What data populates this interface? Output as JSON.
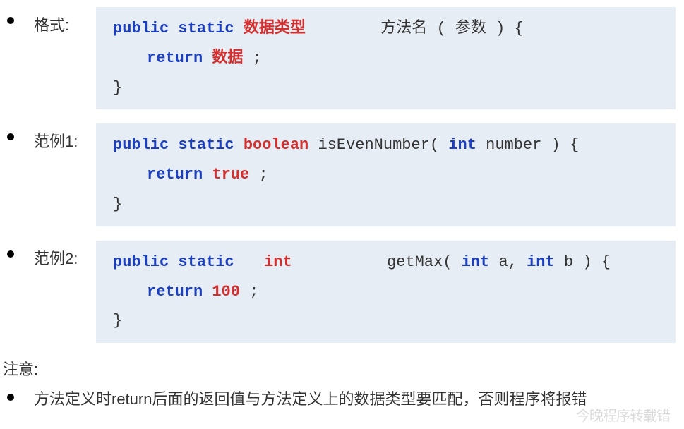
{
  "sections": {
    "format_label": "格式:",
    "example1_label": "范例1:",
    "example2_label": "范例2:"
  },
  "code1": {
    "l1_kw": "public static",
    "l1_red": "数据类型",
    "l1_rest": "方法名 ( 参数 ) {",
    "l2_kw": "return",
    "l2_red": "数据",
    "l2_end": ";",
    "l3": "}"
  },
  "code2": {
    "l1_kw": "public static",
    "l1_red": "boolean",
    "l1_rest": "isEvenNumber(",
    "l1_kw2": "int",
    "l1_rest2": " number ) {",
    "l2_kw": "return",
    "l2_red": "true",
    "l2_end": ";",
    "l3": "}"
  },
  "code3": {
    "l1_kw": "public static",
    "l1_red": "int",
    "l1_rest": "getMax(",
    "l1_kw2": "int",
    "l1_mid": " a,",
    "l1_kw3": "int",
    "l1_rest2": " b ) {",
    "l2_kw": "return",
    "l2_red": "100",
    "l2_end": ";",
    "l3": "}"
  },
  "notice": {
    "header": "注意:",
    "line1": "方法定义时return后面的返回值与方法定义上的数据类型要匹配，否则程序将报错"
  },
  "watermark": "今晚程序转载错"
}
